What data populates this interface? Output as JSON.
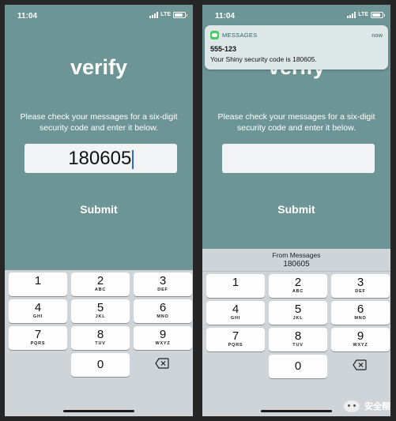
{
  "left_screen": {
    "status": {
      "time": "11:04",
      "network": "LTE"
    },
    "title": "verify",
    "instructions": "Please check your messages for a six-digit security code and enter it below.",
    "code_value": "180605",
    "submit_label": "Submit"
  },
  "right_screen": {
    "status": {
      "time": "11:04",
      "network": "LTE"
    },
    "title": "verify",
    "instructions": "Please check your messages for a six-digit security code and enter it below.",
    "code_value": "",
    "submit_label": "Submit",
    "notification": {
      "app": "MESSAGES",
      "time": "now",
      "sender": "555-123",
      "message": "Your Shiny security code is 180605.",
      "icon": "messages-app-icon"
    },
    "suggestion": {
      "label": "From Messages",
      "code": "180605"
    }
  },
  "keypad": [
    {
      "num": "1",
      "letters": ""
    },
    {
      "num": "2",
      "letters": "ABC"
    },
    {
      "num": "3",
      "letters": "DEF"
    },
    {
      "num": "4",
      "letters": "GHI"
    },
    {
      "num": "5",
      "letters": "JKL"
    },
    {
      "num": "6",
      "letters": "MNO"
    },
    {
      "num": "7",
      "letters": "PQRS"
    },
    {
      "num": "8",
      "letters": "TUV"
    },
    {
      "num": "9",
      "letters": "WXYZ"
    },
    {
      "num": "0",
      "letters": ""
    }
  ],
  "watermark": "安全帮",
  "colors": {
    "screen_bg": "#6d9596",
    "keyboard_bg": "#cfd4d9",
    "caret": "#2f68d6",
    "notification_bg": "#dde7e8",
    "messages_green": "#4cc95f"
  }
}
